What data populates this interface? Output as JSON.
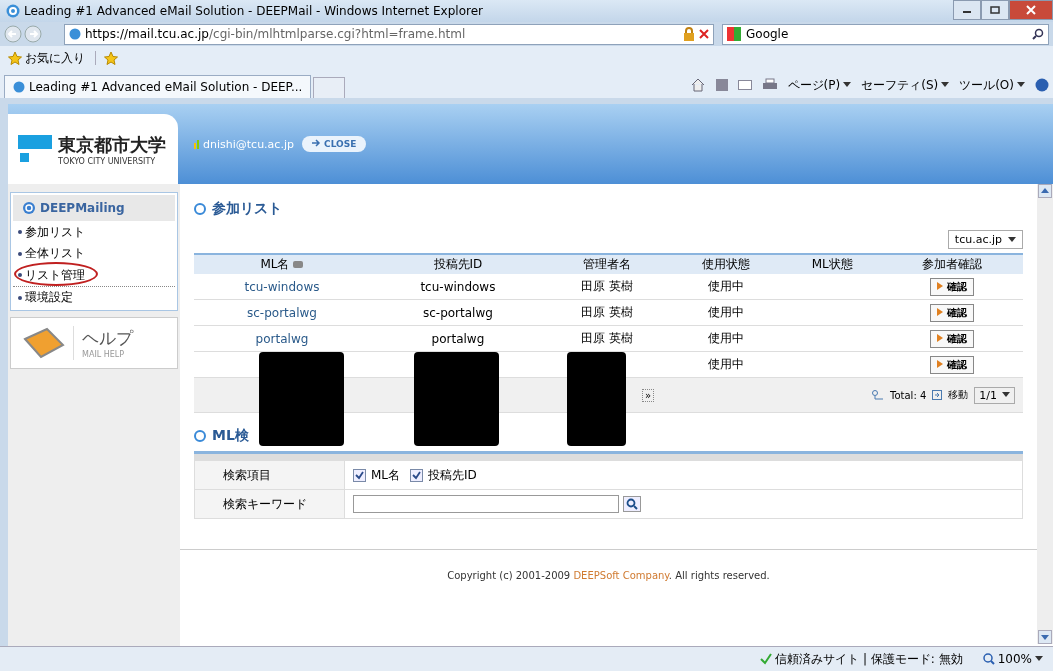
{
  "window": {
    "title": "Leading #1 Advanced eMail Solution - DEEPMail - Windows Internet Explorer"
  },
  "address_bar": {
    "url_host": "https://mail.tcu.ac.jp",
    "url_path": "/cgi-bin/mlhtmlparse.cgi?html=frame.html",
    "search_provider": "Google"
  },
  "favorites_bar": {
    "label": "お気に入り"
  },
  "tab": {
    "title": "Leading #1 Advanced eMail Solution - DEEP..."
  },
  "command_bar": [
    "ページ(P)",
    "セーフティ(S)",
    "ツール(O)"
  ],
  "header": {
    "logo_title": "東京都市大学",
    "logo_subtitle": "TOKYO CITY UNIVERSITY",
    "user": "dnishi@tcu.ac.jp",
    "close_button": "CLOSE"
  },
  "sidebar": {
    "title": "DEEPMailing",
    "items": [
      {
        "label": "参加リスト",
        "circled": false
      },
      {
        "label": "全体リスト",
        "circled": false
      },
      {
        "label": "リスト管理",
        "circled": true
      },
      {
        "label": "環境設定",
        "circled": false
      }
    ],
    "help": {
      "title": "ヘルプ",
      "subtitle": "MAIL HELP"
    }
  },
  "list": {
    "title": "参加リスト",
    "domain": "tcu.ac.jp",
    "columns": [
      "ML名",
      "投稿先ID",
      "管理者名",
      "使用状態",
      "ML状態",
      "参加者確認"
    ],
    "rows": [
      {
        "ml_name": "tcu-windows",
        "post_id": "tcu-windows",
        "admin": "田原 英樹",
        "usage": "使用中",
        "confirm": "確認"
      },
      {
        "ml_name": "sc-portalwg",
        "post_id": "sc-portalwg",
        "admin": "田原 英樹",
        "usage": "使用中",
        "confirm": "確認"
      },
      {
        "ml_name": "portalwg",
        "post_id": "portalwg",
        "admin": "田原 英樹",
        "usage": "使用中",
        "confirm": "確認"
      },
      {
        "ml_name": "",
        "post_id": "",
        "admin": "",
        "usage": "使用中",
        "confirm": "確認"
      }
    ],
    "pager_last": "»",
    "total": "Total: 4",
    "move": "移動",
    "page": "1/1"
  },
  "search": {
    "title": "ML検",
    "fields": [
      {
        "label": "検索項目",
        "options": [
          {
            "label": "ML名",
            "checked": true
          },
          {
            "label": "投稿先ID",
            "checked": true
          }
        ]
      },
      {
        "label": "検索キーワード"
      }
    ]
  },
  "footer": {
    "prefix": "Copyright (c) 2001-2009 ",
    "company": "DEEPSoft Company",
    "suffix": ". All rights reserved."
  },
  "status_bar": {
    "zone": "信頼済みサイト | 保護モード: 無効",
    "zoom": "100%"
  }
}
